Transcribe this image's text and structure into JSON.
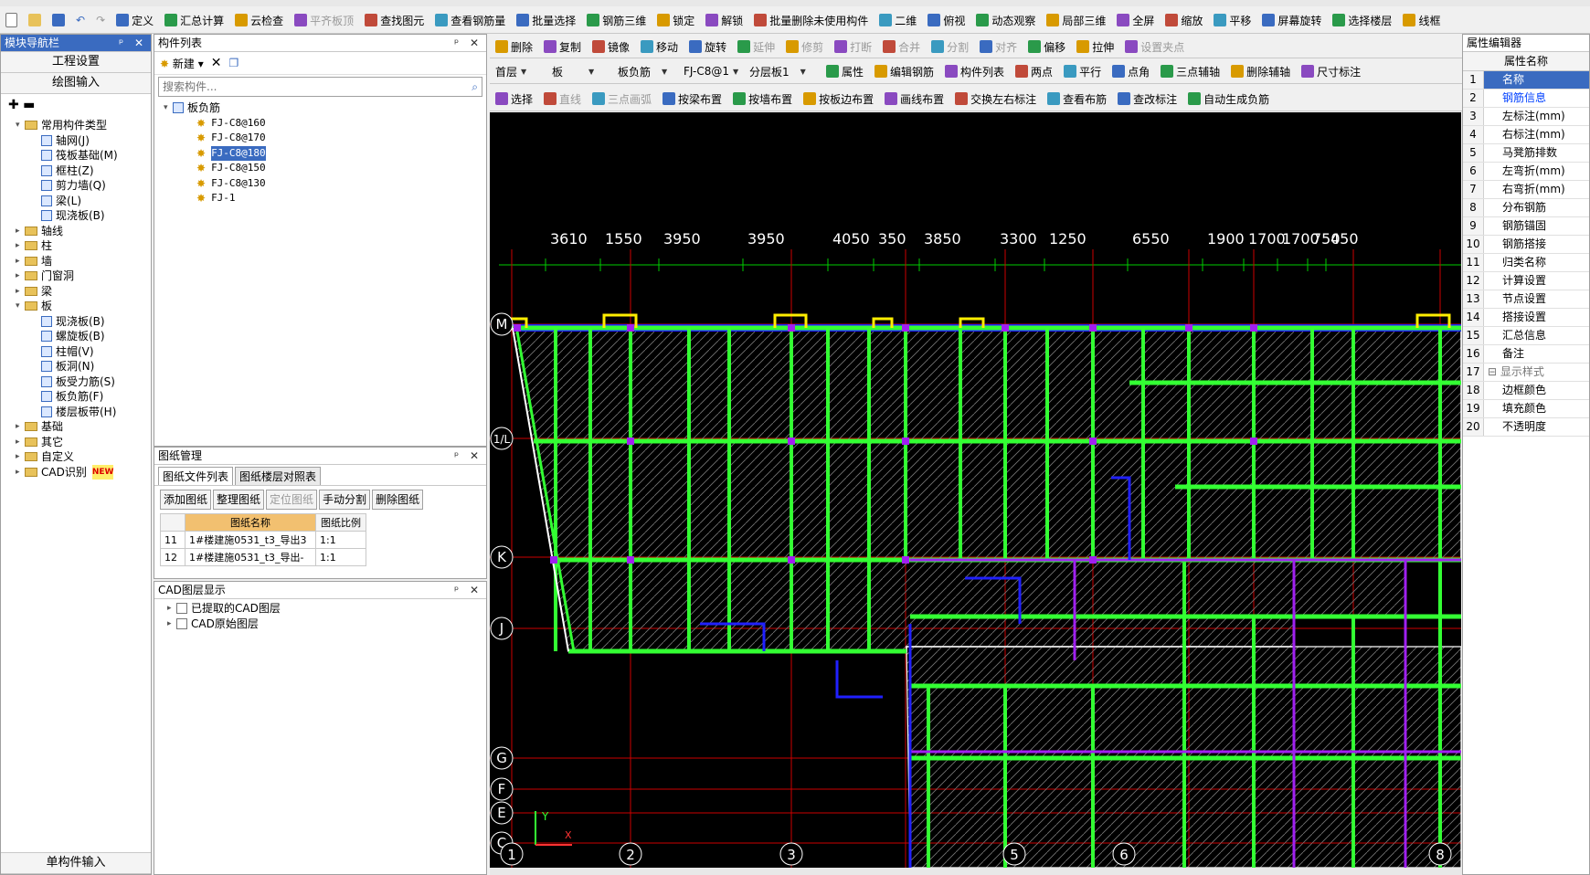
{
  "toolbar1": [
    "定义",
    "汇总计算",
    "云检查",
    "平齐板顶",
    "查找图元",
    "查看钢筋量",
    "批量选择",
    "钢筋三维",
    "锁定",
    "解锁",
    "批量删除未使用构件",
    "二维",
    "俯视",
    "动态观察",
    "局部三维",
    "全屏",
    "缩放",
    "平移",
    "屏幕旋转",
    "选择楼层",
    "线框"
  ],
  "toolbar2": [
    "删除",
    "复制",
    "镜像",
    "移动",
    "旋转",
    "延伸",
    "修剪",
    "打断",
    "合并",
    "分割",
    "对齐",
    "偏移",
    "拉伸",
    "设置夹点"
  ],
  "selectors": {
    "floor": "首层",
    "type": "板",
    "sub": "板负筋",
    "comp": "FJ-C8@1",
    "layer": "分层板1"
  },
  "tb2_right": [
    "属性",
    "编辑钢筋",
    "构件列表",
    "两点",
    "平行",
    "点角",
    "三点辅轴",
    "删除辅轴",
    "尺寸标注"
  ],
  "toolbar3": [
    "选择",
    "直线",
    "三点画弧",
    "按梁布置",
    "按墙布置",
    "按板边布置",
    "画线布置",
    "交换左右标注",
    "查看布筋",
    "查改标注",
    "自动生成负筋"
  ],
  "left_panel": {
    "title": "模块导航栏",
    "btn1": "工程设置",
    "btn2": "绘图输入",
    "bottom": "单构件输入",
    "tree": [
      {
        "level": 0,
        "exp": "▾",
        "type": "folder",
        "label": "常用构件类型"
      },
      {
        "level": 1,
        "exp": "",
        "type": "leaf",
        "label": "轴网(J)"
      },
      {
        "level": 1,
        "exp": "",
        "type": "leaf",
        "label": "筏板基础(M)"
      },
      {
        "level": 1,
        "exp": "",
        "type": "leaf",
        "label": "框柱(Z)"
      },
      {
        "level": 1,
        "exp": "",
        "type": "leaf",
        "label": "剪力墙(Q)"
      },
      {
        "level": 1,
        "exp": "",
        "type": "leaf",
        "label": "梁(L)"
      },
      {
        "level": 1,
        "exp": "",
        "type": "leaf",
        "label": "现浇板(B)"
      },
      {
        "level": 0,
        "exp": "▸",
        "type": "folder",
        "label": "轴线"
      },
      {
        "level": 0,
        "exp": "▸",
        "type": "folder",
        "label": "柱"
      },
      {
        "level": 0,
        "exp": "▸",
        "type": "folder",
        "label": "墙"
      },
      {
        "level": 0,
        "exp": "▸",
        "type": "folder",
        "label": "门窗洞"
      },
      {
        "level": 0,
        "exp": "▸",
        "type": "folder",
        "label": "梁"
      },
      {
        "level": 0,
        "exp": "▾",
        "type": "folder",
        "label": "板"
      },
      {
        "level": 1,
        "exp": "",
        "type": "leaf",
        "label": "现浇板(B)"
      },
      {
        "level": 1,
        "exp": "",
        "type": "leaf",
        "label": "螺旋板(B)"
      },
      {
        "level": 1,
        "exp": "",
        "type": "leaf",
        "label": "柱帽(V)"
      },
      {
        "level": 1,
        "exp": "",
        "type": "leaf",
        "label": "板洞(N)"
      },
      {
        "level": 1,
        "exp": "",
        "type": "leaf",
        "label": "板受力筋(S)"
      },
      {
        "level": 1,
        "exp": "",
        "type": "leaf",
        "label": "板负筋(F)"
      },
      {
        "level": 1,
        "exp": "",
        "type": "leaf",
        "label": "楼层板带(H)"
      },
      {
        "level": 0,
        "exp": "▸",
        "type": "folder",
        "label": "基础"
      },
      {
        "level": 0,
        "exp": "▸",
        "type": "folder",
        "label": "其它"
      },
      {
        "level": 0,
        "exp": "▸",
        "type": "folder",
        "label": "自定义"
      },
      {
        "level": 0,
        "exp": "▸",
        "type": "folder",
        "label": "CAD识别"
      }
    ],
    "new_badge": "NEW"
  },
  "component_list": {
    "title": "构件列表",
    "new_label": "新建",
    "search_placeholder": "搜索构件...",
    "root": "板负筋",
    "items": [
      "FJ-C8@160",
      "FJ-C8@170",
      "FJ-C8@180",
      "FJ-C8@150",
      "FJ-C8@130",
      "FJ-1"
    ],
    "selected_index": 2
  },
  "drawing_mgmt": {
    "title": "图纸管理",
    "tabs": [
      "图纸文件列表",
      "图纸楼层对照表"
    ],
    "buttons": [
      "添加图纸",
      "整理图纸",
      "定位图纸",
      "手动分割",
      "删除图纸"
    ],
    "columns": [
      "",
      "图纸名称",
      "图纸比例"
    ],
    "rows": [
      [
        "11",
        "1#楼建施0531_t3_导出3",
        "1:1"
      ],
      [
        "12",
        "1#楼建施0531_t3_导出-",
        "1:1"
      ]
    ]
  },
  "cad_layers": {
    "title": "CAD图层显示",
    "items": [
      "已提取的CAD图层",
      "CAD原始图层"
    ]
  },
  "canvas": {
    "dims": [
      "3610",
      "1550",
      "3950",
      "3950",
      "4050",
      "350",
      "3850",
      "3300",
      "1250",
      "6550",
      "1900",
      "1700",
      "1700",
      "750",
      "450"
    ],
    "axes_left": [
      "M",
      "1/L",
      "K",
      "J",
      "G",
      "F",
      "E",
      "C"
    ],
    "axes_bottom": [
      "1",
      "2",
      "3",
      "5",
      "6",
      "8"
    ],
    "y_label": "Y",
    "x_label": "X"
  },
  "prop_editor": {
    "title": "属性编辑器",
    "header": "属性名称",
    "rows": [
      {
        "n": "1",
        "label": "名称",
        "sel": true
      },
      {
        "n": "2",
        "label": "钢筋信息",
        "blue": true
      },
      {
        "n": "3",
        "label": "左标注(mm)"
      },
      {
        "n": "4",
        "label": "右标注(mm)"
      },
      {
        "n": "5",
        "label": "马凳筋排数"
      },
      {
        "n": "6",
        "label": "左弯折(mm)"
      },
      {
        "n": "7",
        "label": "右弯折(mm)"
      },
      {
        "n": "8",
        "label": "分布钢筋"
      },
      {
        "n": "9",
        "label": "钢筋锚固"
      },
      {
        "n": "10",
        "label": "钢筋搭接"
      },
      {
        "n": "11",
        "label": "归类名称"
      },
      {
        "n": "12",
        "label": "计算设置"
      },
      {
        "n": "13",
        "label": "节点设置"
      },
      {
        "n": "14",
        "label": "搭接设置"
      },
      {
        "n": "15",
        "label": "汇总信息"
      },
      {
        "n": "16",
        "label": "备注"
      },
      {
        "n": "17",
        "label": "显示样式",
        "group": true
      },
      {
        "n": "18",
        "label": "边框颜色"
      },
      {
        "n": "19",
        "label": "填充颜色"
      },
      {
        "n": "20",
        "label": "不透明度"
      }
    ]
  }
}
